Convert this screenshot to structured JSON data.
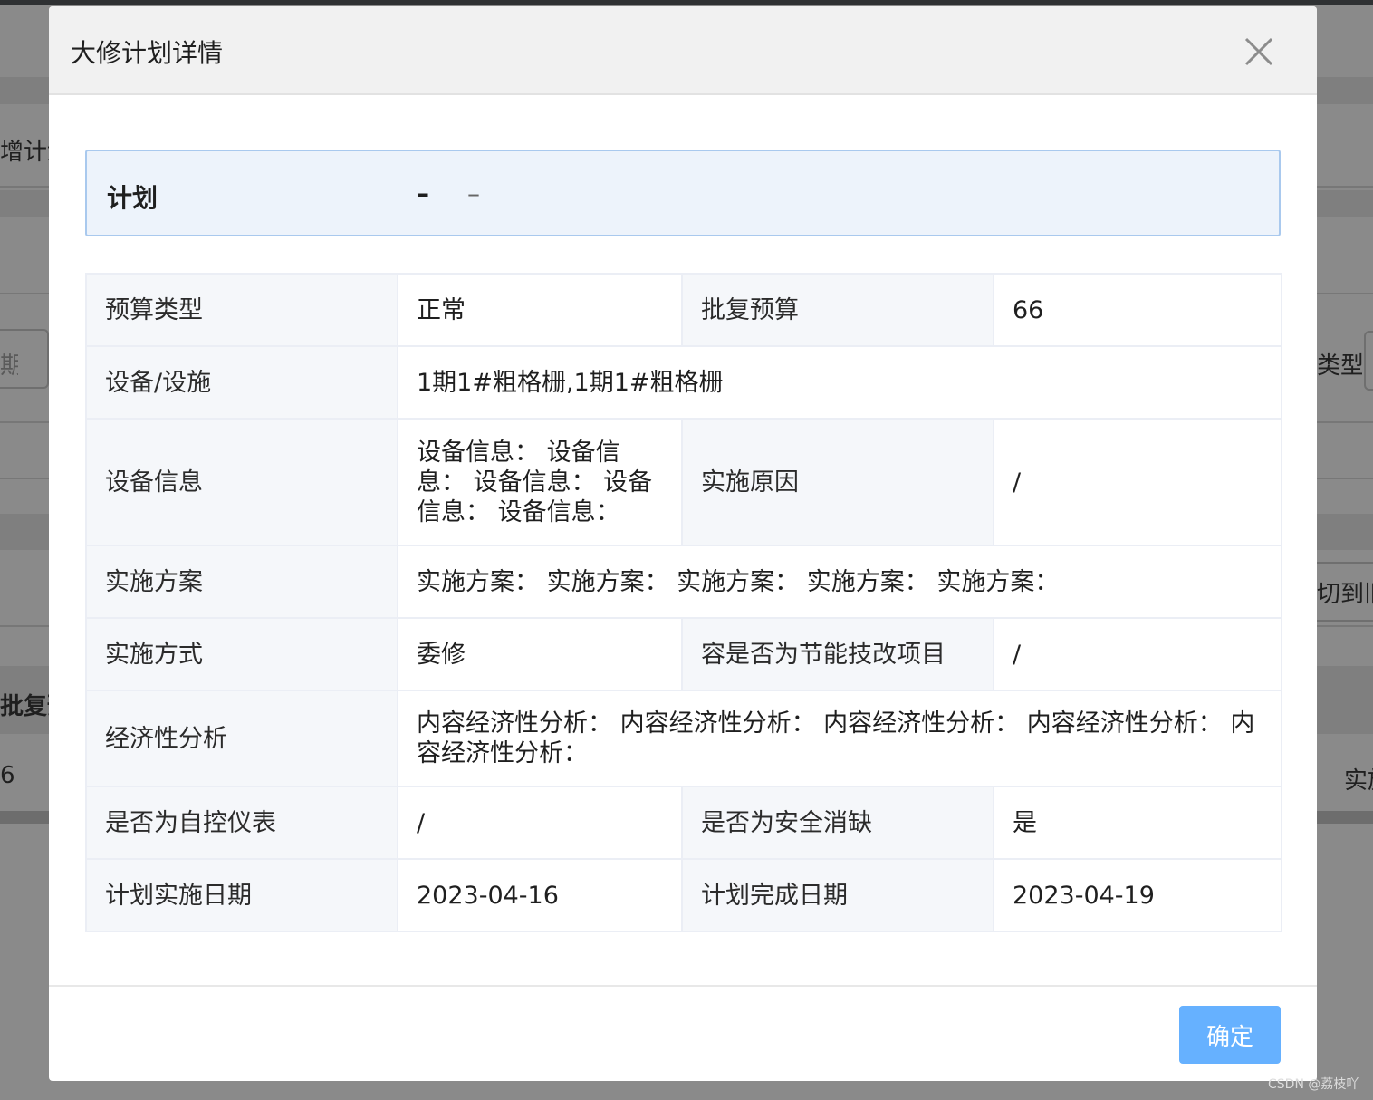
{
  "background": {
    "fragments": {
      "left_title": "增计划",
      "left_input": "期",
      "left_budget": "批复预",
      "left_value": "6",
      "right_type": "类型：",
      "right_old": "切到旧版",
      "right_impl": "实施"
    }
  },
  "dialog": {
    "title": "大修计划详情",
    "close_icon": "close-icon",
    "plan": {
      "label": "计划",
      "value_dash_1": "–",
      "value_dash_2": "–"
    },
    "rows": {
      "budget_type_label": "预算类型",
      "budget_type_value": "正常",
      "approved_budget_label": "批复预算",
      "approved_budget_value": "66",
      "equipment_label": "设备/设施",
      "equipment_value": "1期1#粗格栅,1期1#粗格栅",
      "equipment_info_label": "设备信息",
      "equipment_info_value": "设备信息：   设备信息：   设备信息：   设备信息：   设备信息：",
      "reason_label": "实施原因",
      "reason_value": "/",
      "scheme_label": "实施方案",
      "scheme_value": "实施方案：   实施方案：   实施方案：   实施方案：   实施方案：",
      "method_label": "实施方式",
      "method_value": "委修",
      "energy_label": "容是否为节能技改项目",
      "energy_value": "/",
      "economic_label": "经济性分析",
      "economic_value": "内容经济性分析：   内容经济性分析：   内容经济性分析：   内容经济性分析：   内容经济性分析：",
      "autocontrol_label": "是否为自控仪表",
      "autocontrol_value": "/",
      "safety_label": "是否为安全消缺",
      "safety_value": "是",
      "start_date_label": "计划实施日期",
      "start_date_value": "2023-04-16",
      "end_date_label": "计划完成日期",
      "end_date_value": "2023-04-19"
    },
    "confirm_label": "确定"
  },
  "watermark": "CSDN @荔枝吖",
  "colors": {
    "overlay": "#8a8a8a",
    "primary_button": "#66b1ff",
    "banner_bg": "#edf3fb",
    "banner_border": "#a9c9ee",
    "label_bg": "#f5f7fa",
    "border": "#ebeef5"
  }
}
